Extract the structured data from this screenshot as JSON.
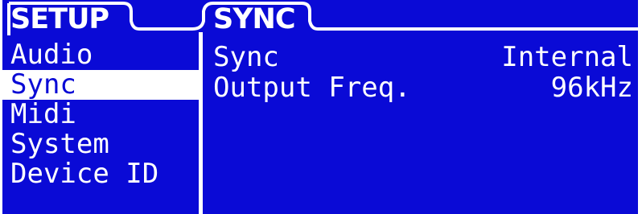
{
  "tabs": {
    "setup": "SETUP",
    "sync": "SYNC"
  },
  "menu": {
    "items": [
      {
        "label": "Audio"
      },
      {
        "label": "Sync",
        "selected": true
      },
      {
        "label": "Midi"
      },
      {
        "label": "System"
      },
      {
        "label": "Device ID"
      }
    ]
  },
  "params": [
    {
      "label": "Sync",
      "value": "Internal"
    },
    {
      "label": "Output Freq.",
      "value": "96kHz"
    }
  ],
  "colors": {
    "background": "#0a0ad6",
    "foreground": "#ffffff"
  }
}
